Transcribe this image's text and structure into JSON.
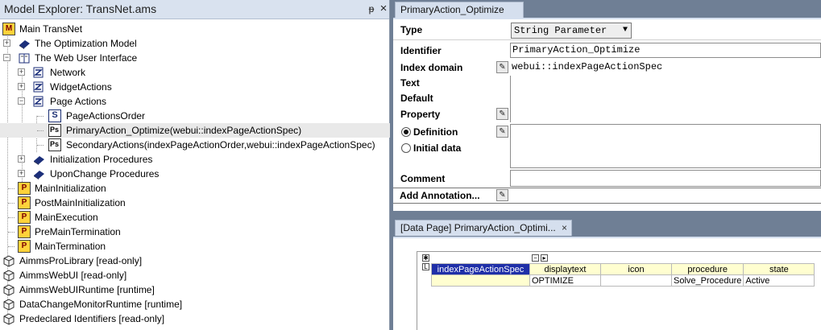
{
  "explorer": {
    "title": "Model Explorer: TransNet.ams",
    "pin_glyph": "ᵽ",
    "close_glyph": "×",
    "tree": [
      {
        "label": "Main TransNet",
        "icon": "main-model-icon"
      },
      {
        "label": "The Optimization Model",
        "icon": "book-icon"
      },
      {
        "label": "The Web User Interface",
        "icon": "open-book-icon"
      },
      {
        "label": "Network",
        "icon": "section-icon"
      },
      {
        "label": "WidgetActions",
        "icon": "section-icon"
      },
      {
        "label": "Page Actions",
        "icon": "section-icon"
      },
      {
        "label": "PageActionsOrder",
        "icon": "set-icon"
      },
      {
        "label": "PrimaryAction_Optimize(webui::indexPageActionSpec)",
        "icon": "string-parameter-icon"
      },
      {
        "label": "SecondaryActions(indexPageActionOrder,webui::indexPageActionSpec)",
        "icon": "string-parameter-icon"
      },
      {
        "label": "Initialization Procedures",
        "icon": "book-icon"
      },
      {
        "label": "UponChange Procedures",
        "icon": "book-icon"
      },
      {
        "label": "MainInitialization",
        "icon": "procedure-icon"
      },
      {
        "label": "PostMainInitialization",
        "icon": "procedure-icon"
      },
      {
        "label": "MainExecution",
        "icon": "procedure-icon"
      },
      {
        "label": "PreMainTermination",
        "icon": "procedure-icon"
      },
      {
        "label": "MainTermination",
        "icon": "procedure-icon"
      },
      {
        "label": "AimmsProLibrary [read-only]",
        "icon": "library-icon"
      },
      {
        "label": "AimmsWebUI [read-only]",
        "icon": "library-icon"
      },
      {
        "label": "AimmsWebUIRuntime [runtime]",
        "icon": "library-icon"
      },
      {
        "label": "DataChangeMonitorRuntime [runtime]",
        "icon": "library-icon"
      },
      {
        "label": "Predeclared Identifiers [read-only]",
        "icon": "library-icon"
      }
    ],
    "expanders": {
      "plus": "+",
      "minus": "−"
    },
    "icon_glyphs": {
      "procedure": "P",
      "set": "S",
      "string_parameter": "Ps",
      "section": "Z",
      "main": "M"
    }
  },
  "attributes": {
    "tab_label": "PrimaryAction_Optimize",
    "type_label": "Type",
    "type_value": "String Parameter",
    "dropdown_glyph": "▼",
    "identifier_label": "Identifier",
    "identifier_value": "PrimaryAction_Optimize",
    "index_domain_label": "Index domain",
    "index_domain_value": "webui::indexPageActionSpec",
    "text_label": "Text",
    "default_label": "Default",
    "property_label": "Property",
    "definition_label": "Definition",
    "initial_data_label": "Initial data",
    "comment_label": "Comment",
    "add_annotation_label": "Add Annotation...",
    "wizard_glyph": "✎"
  },
  "datapage": {
    "tab_label": "[Data Page] PrimaryAction_Optimi...",
    "close_glyph": "×",
    "index_header": "indexPageActionSpec",
    "columns": [
      "displaytext",
      "icon",
      "procedure",
      "state"
    ],
    "row": [
      "OPTIMIZE",
      "",
      "Solve_Procedure",
      "Active"
    ],
    "pivot_glyph": "✱",
    "label_glyph": "L",
    "collapse_glyph": "−",
    "next_glyph": "▸"
  }
}
